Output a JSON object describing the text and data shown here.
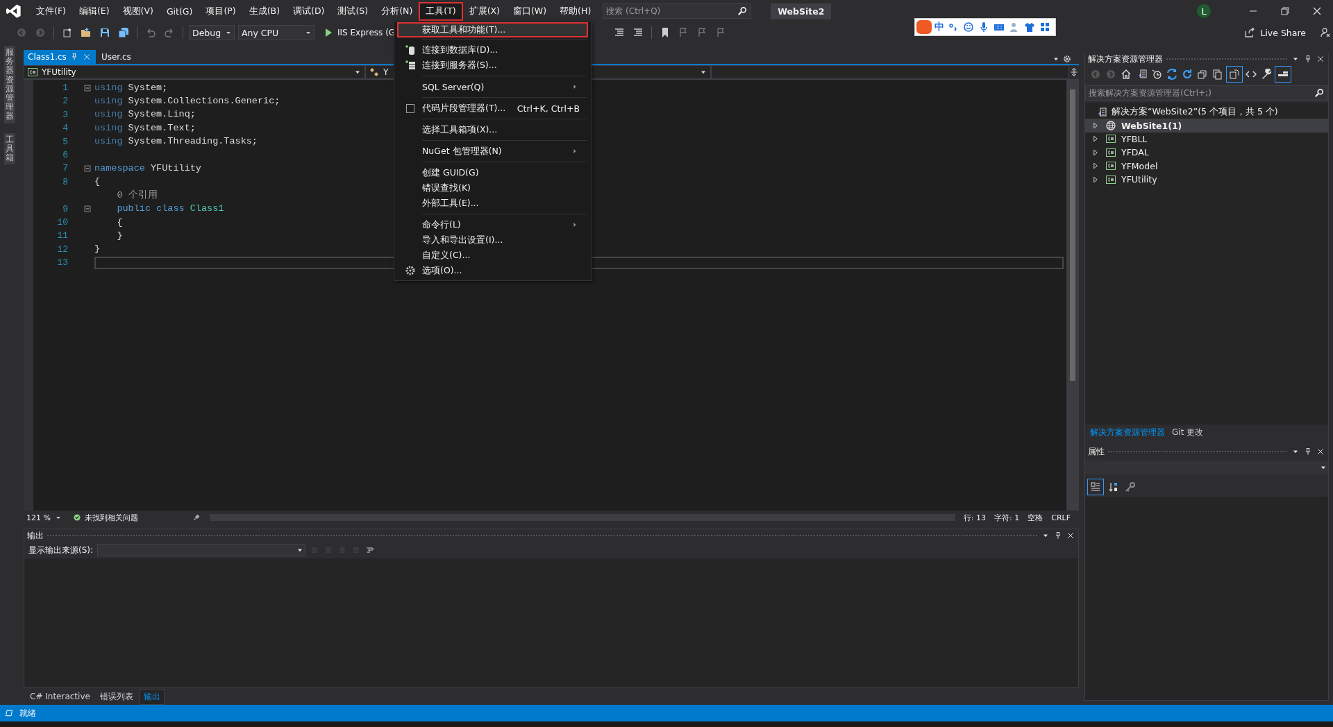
{
  "title_bar": {
    "menus": [
      {
        "label": "文件(F)",
        "selected": false
      },
      {
        "label": "编辑(E)",
        "selected": false
      },
      {
        "label": "视图(V)",
        "selected": false
      },
      {
        "label": "Git(G)",
        "selected": false
      },
      {
        "label": "项目(P)",
        "selected": false
      },
      {
        "label": "生成(B)",
        "selected": false
      },
      {
        "label": "调试(D)",
        "selected": false
      },
      {
        "label": "测试(S)",
        "selected": false
      },
      {
        "label": "分析(N)",
        "selected": false
      },
      {
        "label": "工具(T)",
        "selected": true
      },
      {
        "label": "扩展(X)",
        "selected": false
      },
      {
        "label": "窗口(W)",
        "selected": false
      },
      {
        "label": "帮助(H)",
        "selected": false
      }
    ],
    "search": {
      "placeholder": "搜索 (Ctrl+Q)"
    },
    "solution_name": "WebSite2",
    "account": "L",
    "ime": {
      "mode": "中"
    }
  },
  "toolbar": {
    "configuration": "Debug",
    "platform": "Any CPU",
    "run_target": "IIS Express (G",
    "live_share": "Live Share"
  },
  "left_strip": [
    "服务器资源管理器",
    "工具箱"
  ],
  "document_tabs": [
    {
      "label": "Class1.cs",
      "selected": true
    },
    {
      "label": "User.cs",
      "selected": false
    }
  ],
  "nav_bar": {
    "project": "YFUtility",
    "type": "Y"
  },
  "code_lines": [
    {
      "number": "1",
      "fold": true,
      "current": false,
      "tokens": [
        {
          "kind": "kw",
          "text": "using"
        },
        {
          "kind": "plain",
          "text": " System;"
        }
      ]
    },
    {
      "number": "2",
      "fold": false,
      "current": false,
      "tokens": [
        {
          "kind": "kw",
          "text": "using"
        },
        {
          "kind": "plain",
          "text": " System.Collections.Generic;"
        }
      ]
    },
    {
      "number": "3",
      "fold": false,
      "current": false,
      "tokens": [
        {
          "kind": "kw",
          "text": "using"
        },
        {
          "kind": "plain",
          "text": " System.Linq;"
        }
      ]
    },
    {
      "number": "4",
      "fold": false,
      "current": false,
      "tokens": [
        {
          "kind": "kw",
          "text": "using"
        },
        {
          "kind": "plain",
          "text": " System.Text;"
        }
      ]
    },
    {
      "number": "5",
      "fold": false,
      "current": false,
      "tokens": [
        {
          "kind": "kw",
          "text": "using"
        },
        {
          "kind": "plain",
          "text": " System.Threading.Tasks;"
        }
      ]
    },
    {
      "number": "6",
      "fold": false,
      "current": false
    },
    {
      "number": "7",
      "fold": true,
      "current": false,
      "tokens": [
        {
          "kind": "kw2",
          "text": "namespace"
        },
        {
          "kind": "plain",
          "text": " YFUtility"
        }
      ]
    },
    {
      "number": "8",
      "fold": false,
      "current": false,
      "tokens": [
        {
          "kind": "plain",
          "text": "{"
        }
      ]
    },
    {
      "fold": false,
      "current": false,
      "tokens": [
        {
          "kind": "lens",
          "text": "    0 个引用"
        }
      ]
    },
    {
      "number": "9",
      "fold": true,
      "current": false,
      "tokens": [
        {
          "kind": "kw2",
          "text": "    public class "
        },
        {
          "kind": "type",
          "text": "Class1"
        }
      ]
    },
    {
      "number": "10",
      "fold": false,
      "current": false,
      "tokens": [
        {
          "kind": "plain",
          "text": "    {"
        }
      ]
    },
    {
      "number": "11",
      "fold": false,
      "current": false,
      "tokens": [
        {
          "kind": "plain",
          "text": "    }"
        }
      ]
    },
    {
      "number": "12",
      "fold": false,
      "current": false,
      "tokens": [
        {
          "kind": "plain",
          "text": "}"
        }
      ]
    },
    {
      "number": "13",
      "fold": false,
      "current": true
    }
  ],
  "editor_status": {
    "zoom": "121 %",
    "issues": "未找到相关问题",
    "line": "行: 13",
    "column": "字符: 1",
    "indent": "空格",
    "line_ending": "CRLF"
  },
  "output_panel": {
    "title": "输出",
    "source_label": "显示输出来源(S):"
  },
  "bottom_tabs": [
    {
      "label": "C# Interactive",
      "selected": false
    },
    {
      "label": "错误列表",
      "selected": false
    },
    {
      "label": "输出",
      "selected": true
    }
  ],
  "status_bar": {
    "text": "就绪"
  },
  "solution_explorer": {
    "title": "解决方案资源管理器",
    "search": {
      "placeholder": "搜索解决方案资源管理器(Ctrl+;)"
    },
    "root": "解决方案“WebSite2”(5 个项目，共 5 个)",
    "projects": [
      {
        "label": "WebSite1(1)",
        "kind": "web",
        "selected": true,
        "startup": true
      },
      {
        "label": "YFBLL",
        "kind": "csharp",
        "selected": false,
        "startup": false
      },
      {
        "label": "YFDAL",
        "kind": "csharp",
        "selected": false,
        "startup": false
      },
      {
        "label": "YFModel",
        "kind": "csharp",
        "selected": false,
        "startup": false
      },
      {
        "label": "YFUtility",
        "kind": "csharp",
        "selected": false,
        "startup": false
      }
    ]
  },
  "panel_tabs": [
    {
      "label": "解决方案资源管理器",
      "selected": true
    },
    {
      "label": "Git 更改",
      "selected": false
    }
  ],
  "properties": {
    "title": "属性"
  },
  "tools_menu": [
    [
      {
        "label": "获取工具和功能(T)...",
        "kind": "plain",
        "highlighted": true
      }
    ],
    [
      {
        "label": "连接到数据库(D)...",
        "kind": "database",
        "highlighted": false
      },
      {
        "label": "连接到服务器(S)...",
        "kind": "server",
        "highlighted": false
      }
    ],
    [
      {
        "label": "SQL Server(Q)",
        "kind": "submenu",
        "highlighted": false
      }
    ],
    [
      {
        "label": "代码片段管理器(T)...",
        "kind": "snippet",
        "shortcut": "Ctrl+K, Ctrl+B",
        "highlighted": false
      }
    ],
    [
      {
        "label": "选择工具箱项(X)...",
        "kind": "plain",
        "highlighted": false
      }
    ],
    [
      {
        "label": "NuGet 包管理器(N)",
        "kind": "submenu",
        "highlighted": false
      }
    ],
    [
      {
        "label": "创建 GUID(G)",
        "kind": "plain",
        "highlighted": false
      },
      {
        "label": "错误查找(K)",
        "kind": "plain",
        "highlighted": false
      },
      {
        "label": "外部工具(E)...",
        "kind": "plain",
        "highlighted": false
      }
    ],
    [
      {
        "label": "命令行(L)",
        "kind": "submenu",
        "highlighted": false
      },
      {
        "label": "导入和导出设置(I)...",
        "kind": "plain",
        "highlighted": false
      },
      {
        "label": "自定义(C)...",
        "kind": "plain",
        "highlighted": false
      },
      {
        "label": "选项(O)...",
        "kind": "options",
        "highlighted": false
      }
    ]
  ]
}
